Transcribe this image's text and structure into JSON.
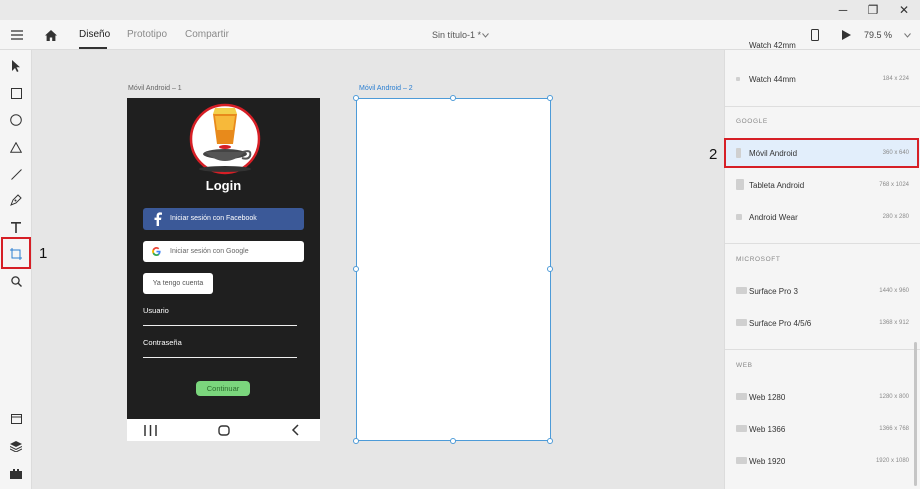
{
  "window": {
    "minimize": "─",
    "restore": "❐",
    "close": "✕"
  },
  "toolbar": {
    "tabs": [
      "Diseño",
      "Prototipo",
      "Compartir"
    ],
    "doc_title": "Sin título-1 *",
    "zoom": "79.5 %"
  },
  "tools": {
    "icons": [
      "select-icon",
      "rectangle-icon",
      "ellipse-icon",
      "polygon-icon",
      "line-icon",
      "pen-icon",
      "text-icon",
      "artboard-icon",
      "zoom-icon"
    ],
    "bottom_icons": [
      "assets-icon",
      "layers-icon",
      "plugins-icon"
    ]
  },
  "annotations": {
    "one": "1",
    "two": "2"
  },
  "artboards": {
    "first_label": "Móvil Android – 1",
    "second_label": "Móvil Android – 2"
  },
  "app": {
    "title": "Login",
    "facebook_button": "Iniciar sesión con Facebook",
    "google_button": "Iniciar sesión con Google",
    "have_account_button": "Ya tengo cuenta",
    "user_label": "Usuario",
    "password_label": "Contraseña",
    "continue_button": "Continuar"
  },
  "panel": {
    "partial_item": {
      "name": "Watch 42mm"
    },
    "watch_item": {
      "name": "Watch 44mm",
      "size": "184 x 224"
    },
    "sections": [
      {
        "title": "GOOGLE",
        "items": [
          {
            "name": "Móvil Android",
            "size": "360 x 640"
          },
          {
            "name": "Tableta Android",
            "size": "768 x 1024"
          },
          {
            "name": "Android Wear",
            "size": "280 x 280"
          }
        ]
      },
      {
        "title": "MICROSOFT",
        "items": [
          {
            "name": "Surface Pro 3",
            "size": "1440 x 960"
          },
          {
            "name": "Surface Pro 4/5/6",
            "size": "1368 x 912"
          }
        ]
      },
      {
        "title": "WEB",
        "items": [
          {
            "name": "Web 1280",
            "size": "1280 x 800"
          },
          {
            "name": "Web 1366",
            "size": "1366 x 768"
          },
          {
            "name": "Web 1920",
            "size": "1920 x 1080"
          }
        ]
      }
    ]
  },
  "colors": {
    "accent_red": "#d61f26",
    "selection_blue": "#4d9bd8",
    "facebook_blue": "#3b5998",
    "continue_green": "#7bd67d",
    "phone_bg": "#1f1f1f"
  }
}
